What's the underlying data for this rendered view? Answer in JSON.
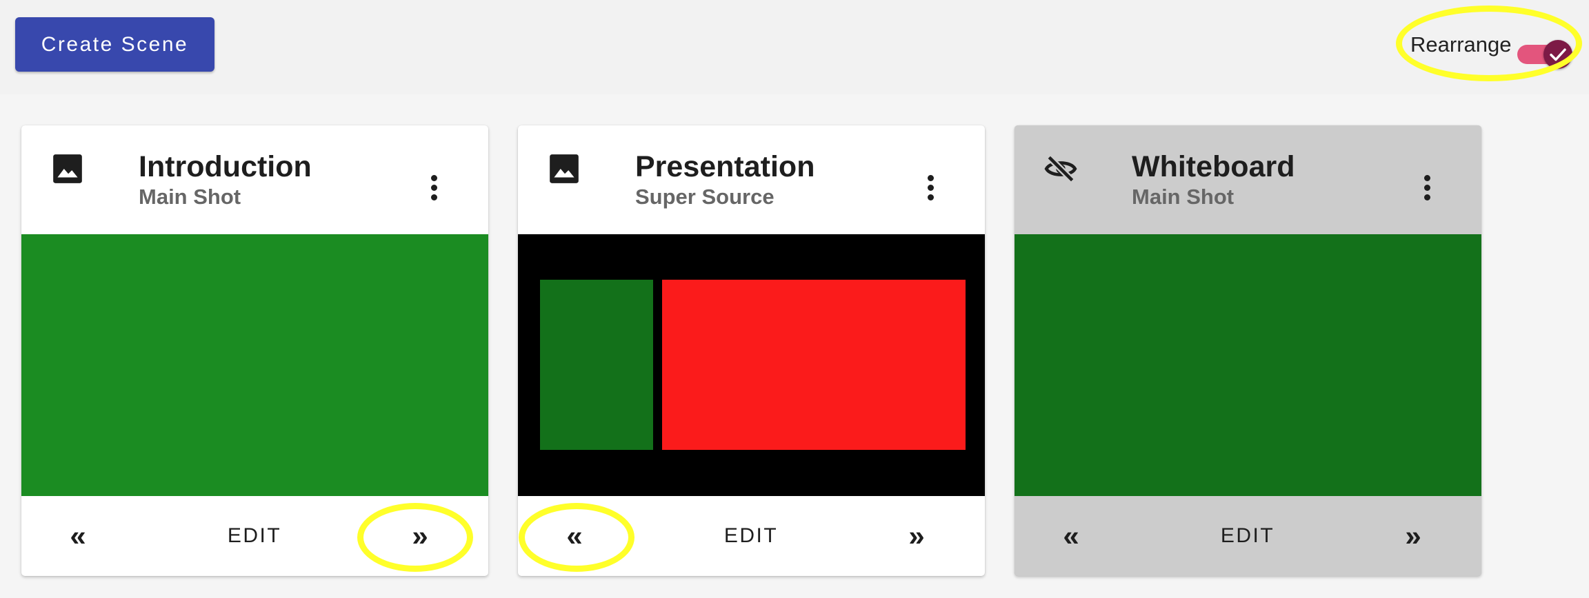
{
  "toolbar": {
    "create_label": "Create Scene",
    "rearrange_label": "Rearrange",
    "rearrange_on": true
  },
  "colors": {
    "primary": "#3848ad",
    "toggle_track": "#e3557d",
    "toggle_thumb": "#7d1a46",
    "highlight": "#ffff2a",
    "preview_green": "#1b8c22",
    "preview_dark_green": "#13711a",
    "preview_red": "#fb1b1b"
  },
  "scenes": [
    {
      "title": "Introduction",
      "subtitle": "Main Shot",
      "icon": "image-icon",
      "visible": true,
      "edit_label": "EDIT",
      "prev_symbol": "«",
      "next_symbol": "»"
    },
    {
      "title": "Presentation",
      "subtitle": "Super Source",
      "icon": "image-icon",
      "visible": true,
      "edit_label": "EDIT",
      "prev_symbol": "«",
      "next_symbol": "»"
    },
    {
      "title": "Whiteboard",
      "subtitle": "Main Shot",
      "icon": "eye-off-icon",
      "visible": false,
      "edit_label": "EDIT",
      "prev_symbol": "«",
      "next_symbol": "»"
    }
  ]
}
